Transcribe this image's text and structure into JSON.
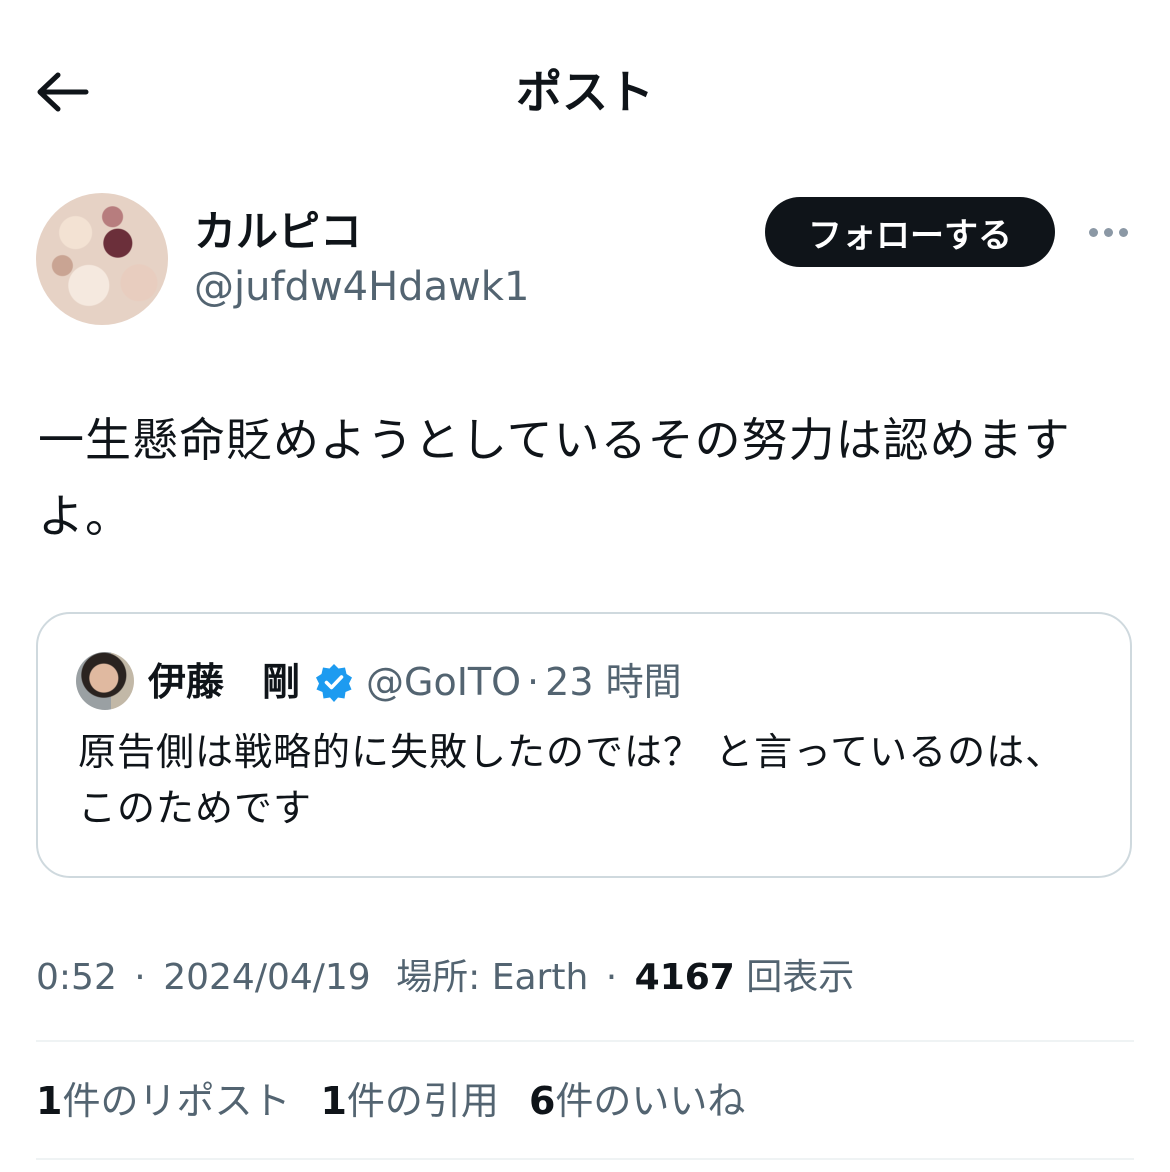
{
  "header": {
    "title": "ポスト",
    "back_icon": "arrow-left-icon"
  },
  "author": {
    "display_name": "カルピコ",
    "handle": "@jufdw4Hdawk1",
    "follow_label": "フォローする",
    "more_icon": "more-horizontal-icon"
  },
  "post": {
    "text": "一生懸命貶めようとしているその努力は認めますよ。"
  },
  "quoted_post": {
    "display_name": "伊藤　剛",
    "verified_icon": "verified-badge-icon",
    "handle": "@GoITO",
    "separator": "·",
    "time": "23 時間",
    "text": "原告側は戦略的に失敗したのでは？ と言っているのは、このためです"
  },
  "meta": {
    "time": "0:52",
    "separator": "·",
    "date": "2024/04/19",
    "location": "場所: Earth",
    "views_count": "4167",
    "views_label": "回表示"
  },
  "stats": {
    "reposts_count": "1",
    "reposts_label": "件のリポスト",
    "quotes_count": "1",
    "quotes_label": "件の引用",
    "likes_count": "6",
    "likes_label": "件のいいね"
  },
  "colors": {
    "text_primary": "#0f1419",
    "text_secondary": "#536471",
    "border": "#cfd9de",
    "verified": "#1d9bf0",
    "button_bg": "#0f1419"
  }
}
